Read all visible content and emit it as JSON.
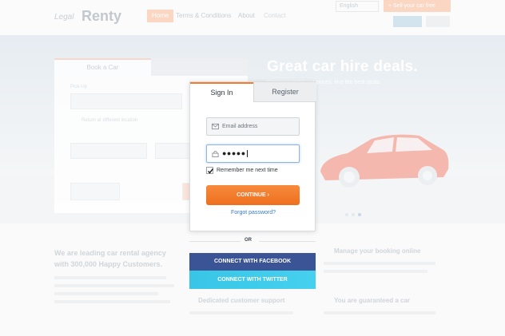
{
  "header": {
    "logo_small": "Legal",
    "logo": "Renty",
    "nav": [
      "Home",
      "Terms & Conditions",
      "About",
      "Contact"
    ],
    "language": "English",
    "sell_button": "+ Sell your car free"
  },
  "hero": {
    "title": "Great car hire deals.",
    "subtitle": "Compare rental car prices, find the best deals"
  },
  "search_panel": {
    "tab_active": "Book a Car",
    "pickup_label": "Pick-Up",
    "return_label": "Return at different location"
  },
  "modal": {
    "tabs": [
      "Sign In",
      "Register"
    ],
    "email_placeholder": "Email address",
    "password_value": "●●●●●",
    "remember_label": "Remember me next time",
    "remember_checked": true,
    "continue_label": "CONTINUE ›",
    "forgot_label": "Forgot password?",
    "or_label": "OR",
    "facebook_label": "CONNECT WITH FACEBOOK",
    "twitter_label": "CONNECT WITH TWITTER",
    "colors": {
      "accent": "#f27b2d",
      "facebook": "#3b5495",
      "twitter": "#40ccec",
      "link": "#3a7bbf"
    }
  },
  "lower": {
    "title": "We are leading car rental agency with 300,000 Happy Customers.",
    "features": [
      "Manage your booking online",
      "Dedicated customer support",
      "You are guaranteed a car"
    ]
  },
  "icons": [
    "envelope-icon",
    "lock-icon",
    "checkmark-icon",
    "chevron-right-icon"
  ]
}
